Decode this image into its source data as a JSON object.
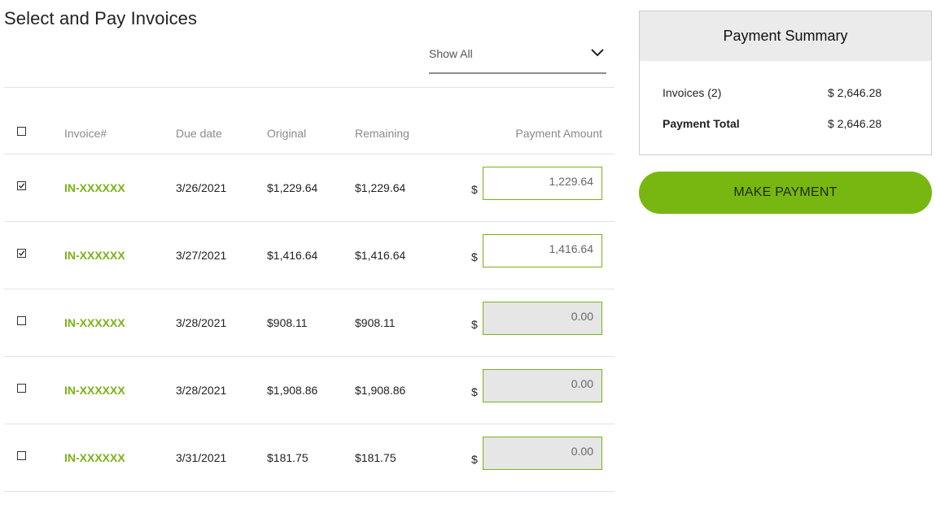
{
  "page": {
    "title": "Select and Pay Invoices",
    "filter": {
      "selected": "Show All"
    }
  },
  "table": {
    "headers": {
      "invoice": "Invoice#",
      "due": "Due date",
      "original": "Original",
      "remaining": "Remaining",
      "payment": "Payment Amount"
    },
    "currency_symbol": "$",
    "rows": [
      {
        "checked": true,
        "invoice": "IN-XXXXXX",
        "due": "3/26/2021",
        "original": "$1,229.64",
        "remaining": "$1,229.64",
        "amount": "1,229.64"
      },
      {
        "checked": true,
        "invoice": "IN-XXXXXX",
        "due": "3/27/2021",
        "original": "$1,416.64",
        "remaining": "$1,416.64",
        "amount": "1,416.64"
      },
      {
        "checked": false,
        "invoice": "IN-XXXXXX",
        "due": "3/28/2021",
        "original": "$908.11",
        "remaining": "$908.11",
        "amount": "0.00"
      },
      {
        "checked": false,
        "invoice": "IN-XXXXXX",
        "due": "3/28/2021",
        "original": "$1,908.86",
        "remaining": "$1,908.86",
        "amount": "0.00"
      },
      {
        "checked": false,
        "invoice": "IN-XXXXXX",
        "due": "3/31/2021",
        "original": "$181.75",
        "remaining": "$181.75",
        "amount": "0.00"
      }
    ]
  },
  "summary": {
    "title": "Payment Summary",
    "invoices_label": "Invoices (2)",
    "invoices_value": "$ 2,646.28",
    "total_label": "Payment Total",
    "total_value": "$ 2,646.28"
  },
  "actions": {
    "make_payment": "MAKE PAYMENT"
  },
  "colors": {
    "accent_green": "#7ab317",
    "button_green": "#78b711",
    "inactive_field": "#e6e6e6"
  },
  "icons": {
    "filter_chevron": "chevron-down-icon",
    "checkbox_check": "check-icon"
  }
}
